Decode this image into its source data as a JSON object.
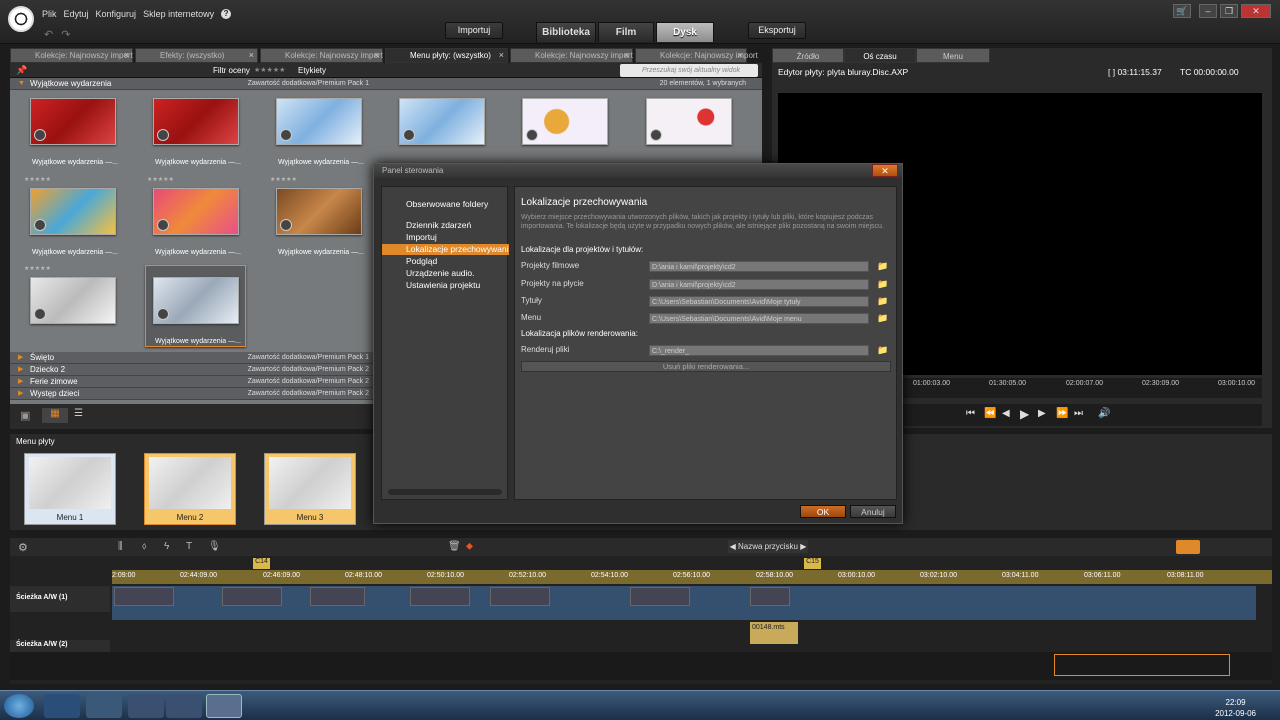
{
  "app": {
    "menu": [
      "Plik",
      "Edytuj",
      "Konfiguruj",
      "Sklep internetowy"
    ],
    "import_btn": "Importuj",
    "export_btn": "Eksportuj",
    "main_tabs": [
      "Biblioteka",
      "Film",
      "Dysk"
    ],
    "active_tab": "Dysk"
  },
  "library": {
    "tabs": [
      "Kolekcje: Najnowszy import",
      "Efekty: (wszystko)",
      "Kolekcje: Najnowszy import",
      "Menu płyty: (wszystko)",
      "Kolekcje: Najnowszy import",
      "Kolekcje: Najnowszy import"
    ],
    "filter_label": "Filtr oceny",
    "tags_label": "Etykiety",
    "search_placeholder": "Przeszukaj swój aktualny widok",
    "group_open": "Wyjątkowe wydarzenia",
    "group_open_pack": "Zawartość dodatkowa/Premium Pack 1",
    "group_count": "20 elementów, 1 wybranych",
    "thumb_label": "Wyjątkowe wydarzenia —...",
    "groups": [
      {
        "name": "Święto",
        "pack": "Zawartość dodatkowa/Premium Pack 1"
      },
      {
        "name": "Dziecko 2",
        "pack": "Zawartość dodatkowa/Premium Pack 2"
      },
      {
        "name": "Ferie zimowe",
        "pack": "Zawartość dodatkowa/Premium Pack 2"
      },
      {
        "name": "Występ dzieci",
        "pack": "Zawartość dodatkowa/Premium Pack 2"
      }
    ]
  },
  "preview": {
    "tabs": [
      "Źródło",
      "Oś czasu",
      "Menu"
    ],
    "title": "Edytor płyty: plyta bluray.Disc.AXP",
    "duration": "[ ] 03:11:15.37",
    "tc": "TC 00:00:00.00",
    "ruler": [
      "01:00:03.00",
      "01:30:05.00",
      "02:00:07.00",
      "02:30:09.00",
      "03:00:10.00"
    ]
  },
  "disc_menu": {
    "title": "Menu płyty",
    "items": [
      "Menu 1",
      "Menu 2",
      "Menu 3"
    ]
  },
  "dialog": {
    "title": "Panel sterowania",
    "close": "✕",
    "nav": [
      "Obserwowane foldery",
      "Dziennik zdarzeń",
      "Importuj",
      "Lokalizacje przechowywania",
      "Podgląd",
      "Urządzenie audio.",
      "Ustawienia projektu"
    ],
    "selected": "Lokalizacje przechowywania",
    "heading": "Lokalizacje przechowywania",
    "description": "Wybierz miejsce przechowywania utworzonych plików, takich jak projekty i tytuły lub pliki, które kopiujesz podczas importowania. Te lokalizacje będą użyte w przypadku nowych plików, ale istniejące pliki pozostaną na swoim miejscu.",
    "section1": "Lokalizacje dla projektów i tytułów:",
    "fields": [
      {
        "label": "Projekty filmowe",
        "value": "D:\\ania i kamil\\projekty\\cd2"
      },
      {
        "label": "Projekty na płycie",
        "value": "D:\\ania i kamil\\projekty\\cd2"
      },
      {
        "label": "Tytuły",
        "value": "C:\\Users\\Sebastian\\Documents\\Avid\\Moje tytuły"
      },
      {
        "label": "Menu",
        "value": "C:\\Users\\Sebastian\\Documents\\Avid\\Moje menu"
      }
    ],
    "section2": "Lokalizacja plików renderowania:",
    "render_label": "Renderuj pliki",
    "render_value": "C:\\_render_",
    "delete_render": "Usuń pliki renderowania...",
    "ok": "OK",
    "cancel": "Anuluj"
  },
  "timeline": {
    "marker_name": "Nazwa przycisku",
    "markers": [
      "C14",
      "C15"
    ],
    "timecodes": [
      "2:09:00",
      "02:44:09.00",
      "02:46:09.00",
      "02:48:10.00",
      "02:50:10.00",
      "02:52:10.00",
      "02:54:10.00",
      "02:56:10.00",
      "02:58:10.00",
      "03:00:10.00",
      "03:02:10.00",
      "03:04:11.00",
      "03:06:11.00",
      "03:08:11.00"
    ],
    "track1": "Ścieżka A/W (1)",
    "track2": "Ścieżka A/W (2)",
    "clip_label": "00148.mts"
  },
  "taskbar": {
    "time": "22:09",
    "date": "2012-09-06"
  }
}
